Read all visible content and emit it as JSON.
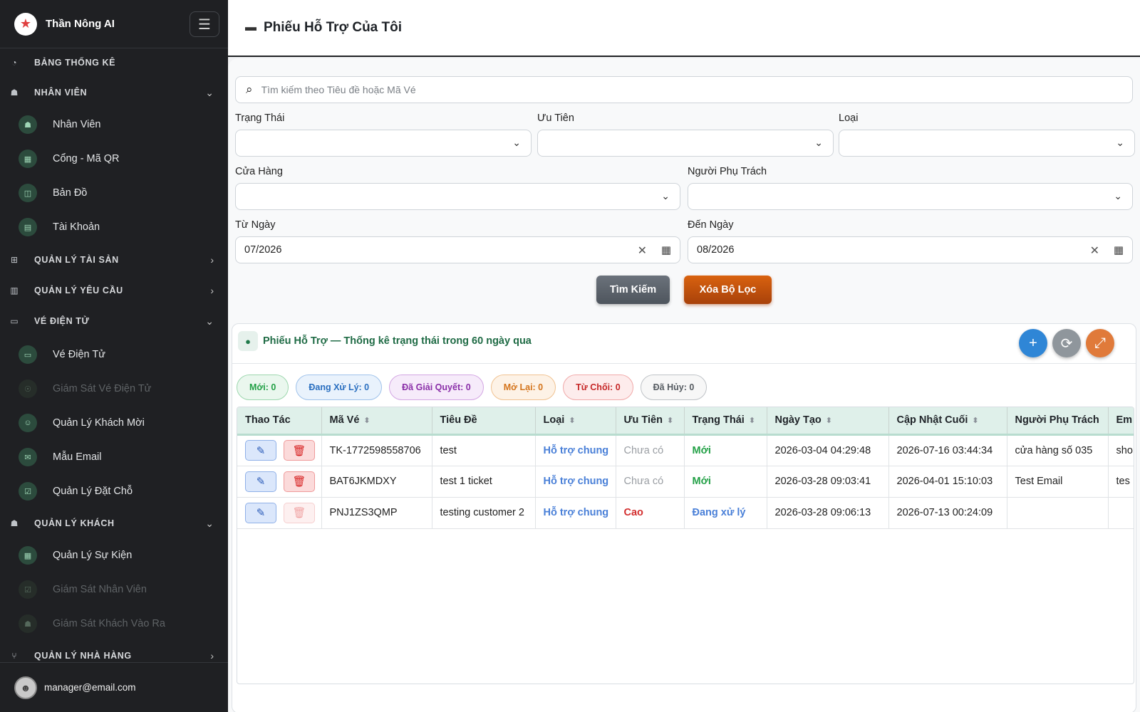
{
  "brand": {
    "name": "Thần Nông AI",
    "logo_icon": "star-logo-icon"
  },
  "topbar": {
    "title": "Phiếu Hỗ Trợ Của Tôi"
  },
  "sidebar": {
    "sections": [
      {
        "label": "BẢNG THỐNG KÊ",
        "icon": "gauge-icon"
      },
      {
        "label": "NHÂN VIÊN",
        "icon": "users-icon",
        "expanded": true
      },
      {
        "label": "QUẢN LÝ TÀI SẢN",
        "icon": "sitemap-icon",
        "expanded": false
      },
      {
        "label": "QUẢN LÝ YÊU CẦU",
        "icon": "clipboard-icon",
        "expanded": false
      },
      {
        "label": "VÉ ĐIỆN TỬ",
        "icon": "ticket-icon",
        "expanded": true
      },
      {
        "label": "QUẢN LÝ KHÁCH",
        "icon": "guests-icon",
        "expanded": true
      },
      {
        "label": "QUẢN LÝ NHÀ HÀNG",
        "icon": "utensils-icon",
        "expanded": false
      }
    ],
    "items": [
      {
        "label": "Nhân Viên"
      },
      {
        "label": "Cổng - Mã QR"
      },
      {
        "label": "Bản Đồ"
      },
      {
        "label": "Tài Khoản"
      },
      {
        "label": "Vé Điện Tử"
      },
      {
        "label": "Giám Sát Vé Điện Tử",
        "disabled": true
      },
      {
        "label": "Quản Lý Khách Mời"
      },
      {
        "label": "Mẫu Email"
      },
      {
        "label": "Quản Lý Đặt Chỗ"
      },
      {
        "label": "Quản Lý Sự Kiện"
      },
      {
        "label": "Giám Sát Nhân Viên",
        "disabled": true
      },
      {
        "label": "Giám Sát Khách Vào Ra",
        "disabled": true
      }
    ],
    "user_email": "manager@email.com"
  },
  "filters": {
    "search_placeholder": "Tìm kiếm theo Tiêu đề hoặc Mã Vé",
    "status_label": "Trạng Thái",
    "priority_label": "Ưu Tiên",
    "type_label": "Loại",
    "store_label": "Cửa Hàng",
    "assignee_label": "Người Phụ Trách",
    "from_label": "Từ Ngày",
    "from_value": "07/2026",
    "to_label": "Đến Ngày",
    "to_value": "08/2026",
    "search_button": "Tìm Kiếm",
    "clear_button": "Xóa Bộ Lọc"
  },
  "panel": {
    "title": "Phiếu Hỗ Trợ — Thống kê trạng thái trong 60 ngày qua",
    "badges": [
      {
        "label": "Mới: 0",
        "color": "#22a046",
        "bg": "#eaf7ee",
        "border": "#9dd7ae"
      },
      {
        "label": "Đang Xử Lý: 0",
        "color": "#2a6fc0",
        "bg": "#e9f2fc",
        "border": "#9fc2ea"
      },
      {
        "label": "Đã Giải Quyết: 0",
        "color": "#8a2fa8",
        "bg": "#f6ebfa",
        "border": "#d3a6e3"
      },
      {
        "label": "Mở Lại: 0",
        "color": "#d4741b",
        "bg": "#fdf2e6",
        "border": "#f0c291"
      },
      {
        "label": "Từ Chối: 0",
        "color": "#c62828",
        "bg": "#fdecec",
        "border": "#f0a9a9"
      },
      {
        "label": "Đã Hủy: 0",
        "color": "#555b61",
        "bg": "#f7f7f7",
        "border": "#bfc3c7"
      }
    ]
  },
  "table": {
    "headers": [
      "Thao Tác",
      "Mã Vé",
      "Tiêu Đề",
      "Loại",
      "Ưu Tiên",
      "Trạng Thái",
      "Ngày Tạo",
      "Cập Nhật Cuối",
      "Người Phụ Trách",
      "Em"
    ],
    "rows": [
      {
        "code": "TK-1772598558706",
        "title": "test",
        "type": "Hỗ trợ chung",
        "priority": "Chưa có",
        "priority_class": "none",
        "status": "Mới",
        "status_class": "moi",
        "created": "2026-03-04 04:29:48",
        "updated": "2026-07-16 03:44:34",
        "assignee": "cửa hàng số 035",
        "email": "sho",
        "delete_enabled": true
      },
      {
        "code": "BAT6JKMDXY",
        "title": "test 1 ticket",
        "type": "Hỗ trợ chung",
        "priority": "Chưa có",
        "priority_class": "none",
        "status": "Mới",
        "status_class": "moi",
        "created": "2026-03-28 09:03:41",
        "updated": "2026-04-01 15:10:03",
        "assignee": "Test Email",
        "email": "tes",
        "delete_enabled": true
      },
      {
        "code": "PNJ1ZS3QMP",
        "title": "testing customer 2",
        "type": "Hỗ trợ chung",
        "priority": "Cao",
        "priority_class": "cao",
        "status": "Đang xử lý",
        "status_class": "dxl",
        "created": "2026-03-28 09:06:13",
        "updated": "2026-07-13 00:24:09",
        "assignee": "",
        "email": "",
        "delete_enabled": false
      }
    ]
  },
  "colors": {
    "sidebar_bg": "#1f2023",
    "accent_green": "#1f6b45",
    "add_button": "#2f86d6",
    "refresh_button": "#8f969c",
    "expand_button": "#e07a3a"
  }
}
